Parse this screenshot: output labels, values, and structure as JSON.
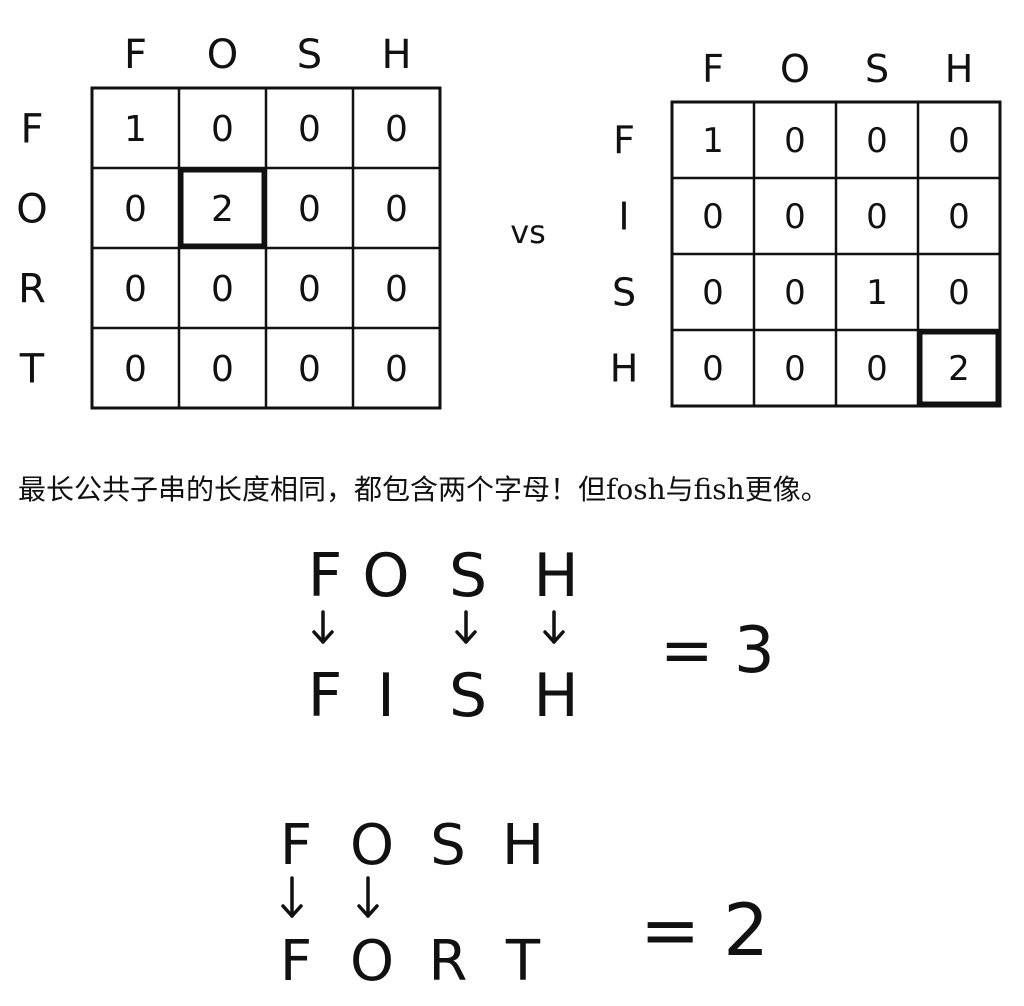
{
  "left_grid": {
    "cols": [
      "F",
      "O",
      "S",
      "H"
    ],
    "rows": [
      "F",
      "O",
      "R",
      "T"
    ],
    "cells": [
      [
        "1",
        "0",
        "0",
        "0"
      ],
      [
        "0",
        "2",
        "0",
        "0"
      ],
      [
        "0",
        "0",
        "0",
        "0"
      ],
      [
        "0",
        "0",
        "0",
        "0"
      ]
    ],
    "highlight": [
      1,
      1
    ]
  },
  "vs_label": "vs",
  "right_grid": {
    "cols": [
      "F",
      "O",
      "S",
      "H"
    ],
    "rows": [
      "F",
      "I",
      "S",
      "H"
    ],
    "cells": [
      [
        "1",
        "0",
        "0",
        "0"
      ],
      [
        "0",
        "0",
        "0",
        "0"
      ],
      [
        "0",
        "0",
        "1",
        "0"
      ],
      [
        "0",
        "0",
        "0",
        "2"
      ]
    ],
    "highlight": [
      3,
      3
    ]
  },
  "caption": "最长公共子串的长度相同，都包含两个字母！但fosh与fish更像。",
  "comparisons": [
    {
      "top": [
        "F",
        "O",
        "S",
        "H"
      ],
      "bottom": [
        "F",
        "I",
        "S",
        "H"
      ],
      "arrows": [
        true,
        false,
        true,
        true
      ],
      "result": "= 3"
    },
    {
      "top": [
        "F",
        "O",
        "S",
        "H"
      ],
      "bottom": [
        "F",
        "O",
        "R",
        "T"
      ],
      "arrows": [
        true,
        true,
        false,
        false
      ],
      "result": "= 2"
    }
  ]
}
